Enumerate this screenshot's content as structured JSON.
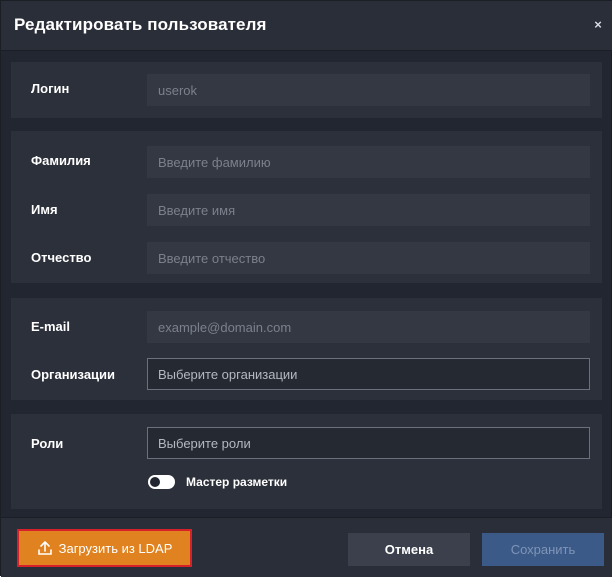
{
  "dialog": {
    "title": "Редактировать пользователя",
    "close_label": "×"
  },
  "login": {
    "label": "Логин",
    "value": "userok"
  },
  "name_section": {
    "last_name": {
      "label": "Фамилия",
      "placeholder": "Введите фамилию"
    },
    "first_name": {
      "label": "Имя",
      "placeholder": "Введите имя"
    },
    "patronymic": {
      "label": "Отчество",
      "placeholder": "Введите отчество"
    }
  },
  "contact_section": {
    "email": {
      "label": "E-mail",
      "placeholder": "example@domain.com"
    },
    "organizations": {
      "label": "Организации",
      "placeholder": "Выберите организации"
    }
  },
  "roles_section": {
    "roles": {
      "label": "Роли",
      "placeholder": "Выберите роли"
    },
    "markup_master": {
      "label": "Мастер разметки",
      "enabled": false
    }
  },
  "footer": {
    "ldap_label": "Загрузить из LDAP",
    "cancel_label": "Отмена",
    "save_label": "Сохранить"
  },
  "colors": {
    "background": "#222630",
    "panel": "#2c303a",
    "accent_orange": "#e0821f",
    "highlight_border": "#d6202a",
    "save_disabled": "#3b5a88"
  }
}
